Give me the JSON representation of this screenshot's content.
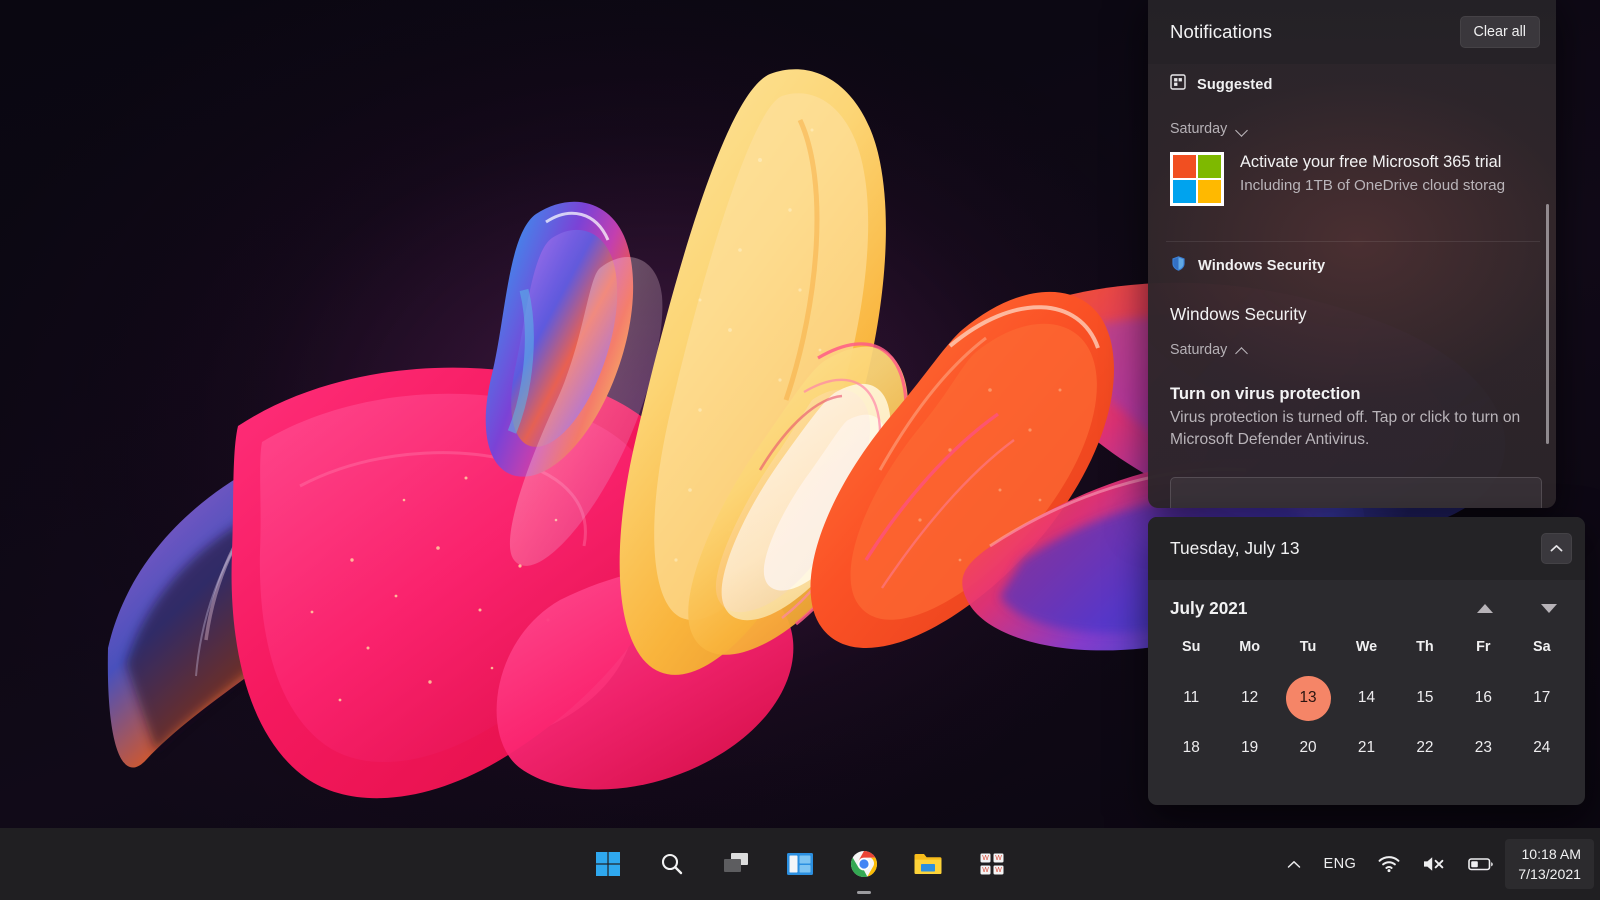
{
  "wallpaper": {
    "name": "windows-11-bloom",
    "background_color": "#0a0711"
  },
  "notifications": {
    "title": "Notifications",
    "clear_all_label": "Clear all",
    "groups": [
      {
        "header_label": "Suggested",
        "header_icon": "suggested-layout-icon",
        "day_label": "Saturday",
        "day_chevron": "chevron-down-icon",
        "items": [
          {
            "app_icon": "microsoft-logo-icon",
            "title": "Activate your free Microsoft 365 trial",
            "body": "Including 1TB of OneDrive cloud storag"
          }
        ]
      },
      {
        "header_label": "Windows Security",
        "header_icon": "shield-icon",
        "section_title": "Windows Security",
        "day_label": "Saturday",
        "day_chevron": "chevron-up-icon",
        "items": [
          {
            "title": "Turn on virus protection",
            "body": "Virus protection is turned off. Tap or click to turn on Microsoft Defender Antivirus."
          }
        ]
      }
    ]
  },
  "calendar": {
    "header_date": "Tuesday, July 13",
    "collapse_icon": "chevron-up-icon",
    "month_label": "July 2021",
    "prev_icon": "triangle-up-icon",
    "next_icon": "triangle-down-icon",
    "day_headers": [
      "Su",
      "Mo",
      "Tu",
      "We",
      "Th",
      "Fr",
      "Sa"
    ],
    "weeks": [
      [
        "11",
        "12",
        "13",
        "14",
        "15",
        "16",
        "17"
      ],
      [
        "18",
        "19",
        "20",
        "21",
        "22",
        "23",
        "24"
      ]
    ],
    "today": "13",
    "today_highlight_color": "#f58567"
  },
  "taskbar": {
    "items": [
      {
        "name": "start",
        "icon": "windows-logo-icon",
        "active": false
      },
      {
        "name": "search",
        "icon": "search-icon",
        "active": false
      },
      {
        "name": "task-view",
        "icon": "task-view-icon",
        "active": false
      },
      {
        "name": "widgets",
        "icon": "widgets-icon",
        "active": false
      },
      {
        "name": "chrome",
        "icon": "chrome-icon",
        "active": true
      },
      {
        "name": "file-explorer",
        "icon": "folder-icon",
        "active": false
      },
      {
        "name": "microsoft-store",
        "icon": "store-icon",
        "active": false
      }
    ],
    "tray": {
      "overflow_icon": "chevron-up-icon",
      "language": "ENG",
      "network_icon": "wifi-icon",
      "volume_icon": "speaker-muted-icon",
      "battery_icon": "battery-icon",
      "time": "10:18 AM",
      "date": "7/13/2021"
    }
  }
}
